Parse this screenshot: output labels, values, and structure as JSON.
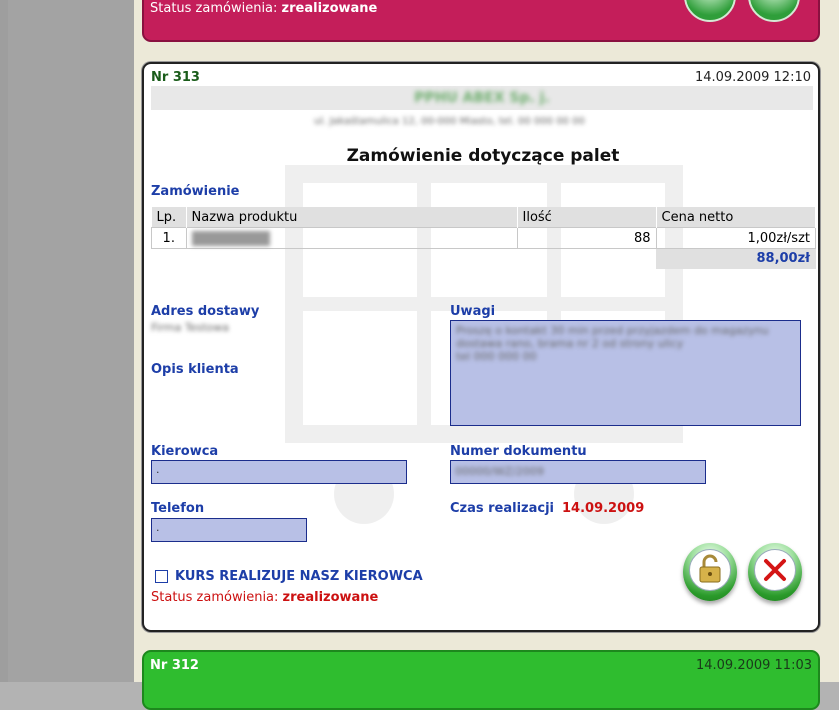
{
  "previous_order": {
    "status_label": "Status zamówienia:",
    "status_value": "zrealizowane"
  },
  "order": {
    "number": "Nr 313",
    "datetime": "14.09.2009 12:10",
    "company_name_redacted": "PPHU ABEX Sp. j.",
    "company_address_redacted": "ul. Jakaśtamulica 12, 00-000 Miasto, tel. 00 000 00 00",
    "title": "Zamówienie dotyczące palet",
    "order_section_label": "Zamówienie",
    "table": {
      "headers": [
        "Lp.",
        "Nazwa produktu",
        "Ilość",
        "Cena netto"
      ],
      "rows": [
        {
          "lp": "1.",
          "name_redacted": "PALETA EUR",
          "qty": "88",
          "price": "1,00zł/szt"
        }
      ],
      "total": "88,00zł"
    },
    "delivery_address_label": "Adres dostawy",
    "delivery_address_redacted": "Firma Testowa",
    "client_desc_label": "Opis klienta",
    "notes_label": "Uwagi",
    "notes_redacted_lines": [
      "Proszę o kontakt 30 min przed przyjazdem do magazynu",
      "dostawa rano, brama nr 2 od strony ulicy",
      "tel 000 000 00"
    ],
    "driver_label": "Kierowca",
    "driver_value": ".",
    "doc_number_label": "Numer dokumentu",
    "doc_number_redacted": "00000/WZ/2009",
    "phone_label": "Telefon",
    "phone_value": ".",
    "realization_time_label": "Czas realizacji",
    "realization_time_value": "14.09.2009",
    "own_driver_checkbox_label": "KURS REALIZUJE NASZ KIEROWCA",
    "status_label": "Status zamówienia:",
    "status_value": "zrealizowane"
  },
  "next_order": {
    "number": "Nr 312",
    "datetime": "14.09.2009 11:03"
  },
  "icons": {
    "unlock": "unlock-icon",
    "cancel": "x-cancel-icon",
    "checkbox": "checkbox"
  },
  "colors": {
    "label_blue": "#1d3ea8",
    "status_red": "#cc1111",
    "prev_card": "#c41e5a",
    "next_card": "#2fbd2f",
    "field_bg": "#b8c0e6"
  }
}
